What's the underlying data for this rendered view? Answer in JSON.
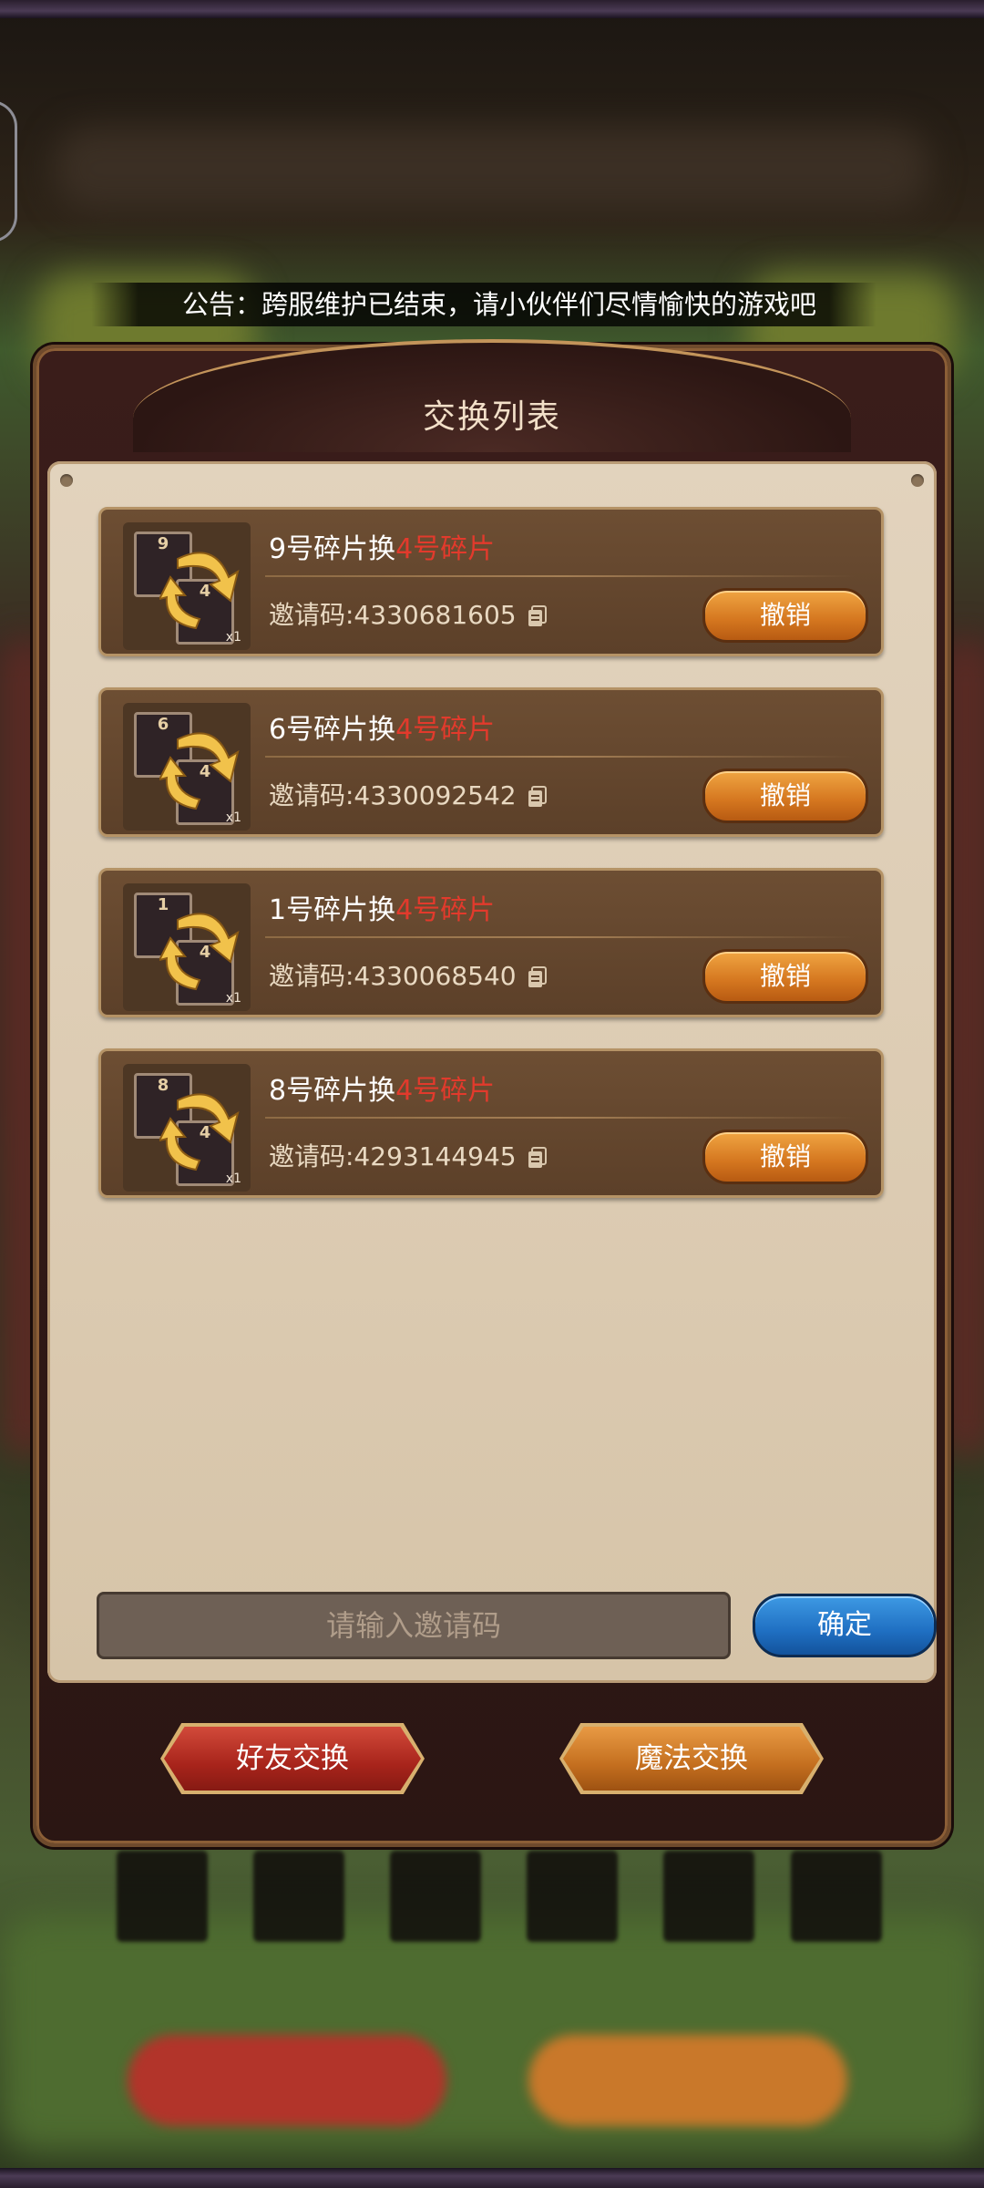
{
  "announcement": "公告：跨服维护已结束，请小伙伴们尽情愉快的游戏吧",
  "dialog": {
    "title": "交换列表",
    "input_placeholder": "请输入邀请码",
    "confirm_label": "确定",
    "friend_exchange_label": "好友交换",
    "magic_exchange_label": "魔法交换"
  },
  "exchanges": [
    {
      "from": "9号碎片换",
      "to": "4号碎片",
      "code": "邀请码:4330681605",
      "cancel_label": "撤销",
      "give_num": "9",
      "get_num": "4",
      "qty": "x1"
    },
    {
      "from": "6号碎片换",
      "to": "4号碎片",
      "code": "邀请码:4330092542",
      "cancel_label": "撤销",
      "give_num": "6",
      "get_num": "4",
      "qty": "x1"
    },
    {
      "from": "1号碎片换",
      "to": "4号碎片",
      "code": "邀请码:4330068540",
      "cancel_label": "撤销",
      "give_num": "1",
      "get_num": "4",
      "qty": "x1"
    },
    {
      "from": "8号碎片换",
      "to": "4号碎片",
      "code": "邀请码:4293144945",
      "cancel_label": "撤销",
      "give_num": "8",
      "get_num": "4",
      "qty": "x1"
    }
  ],
  "colors": {
    "highlight": "#e23a2c",
    "cancel_button": "#e08a2f",
    "confirm_button": "#2a80d2",
    "friend_button": "#b8322a",
    "magic_button": "#cf7a27"
  }
}
